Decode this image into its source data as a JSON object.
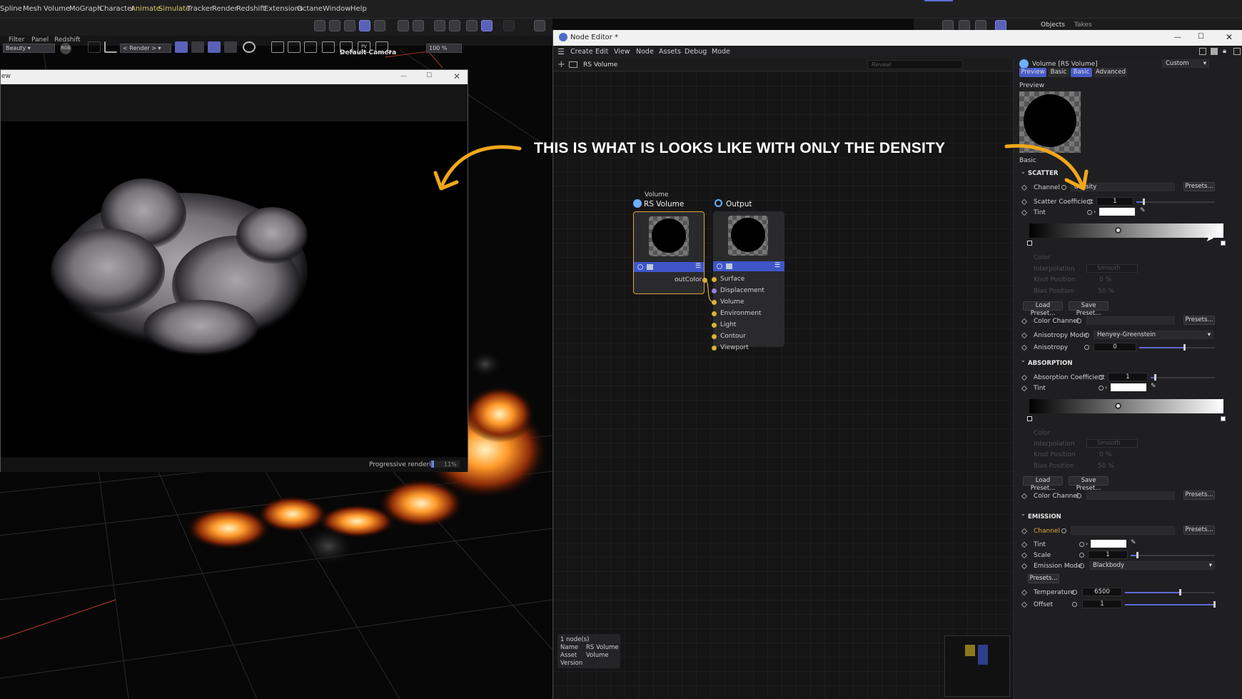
{
  "menubar": {
    "items": [
      "Spline",
      "Mesh",
      "Volume",
      "MoGraph",
      "Character",
      "Animate",
      "Simulate",
      "Tracker",
      "Render",
      "Redshift",
      "Extensions",
      "Octane",
      "Window",
      "Help"
    ],
    "right_tabs": [
      "Objects",
      "Takes"
    ]
  },
  "viewport": {
    "menu": [
      "Filter",
      "Panel",
      "Redshift"
    ],
    "camera_label": "Default Camera"
  },
  "render_view": {
    "title": "ew",
    "aov_select": "Beauty",
    "render_select": "< Render >",
    "zoom": "100 %",
    "status": "Progressive rendering",
    "progress_text": "11%",
    "progress": 0.11,
    "rgb_label": "RGB",
    "pv_label": "PV"
  },
  "annotation": "THIS IS WHAT IS LOOKS LIKE WITH ONLY THE DENSITY",
  "node_editor": {
    "title": "Node Editor *",
    "menu": [
      "Create",
      "Edit",
      "View",
      "Node",
      "Assets",
      "Debug",
      "Mode"
    ],
    "path": "RS Volume",
    "search_placeholder": "Reveal",
    "nodes": {
      "volume": {
        "type_label": "Volume",
        "name": "RS Volume",
        "output_port": "outColor"
      },
      "output": {
        "name": "Output",
        "ports": [
          "Surface",
          "Displacement",
          "Volume",
          "Environment",
          "Light",
          "Contour",
          "Viewport"
        ]
      }
    },
    "info": {
      "count": "1 node(s)",
      "name_label": "Name",
      "name_value": "RS Volume",
      "asset_label": "Asset",
      "asset_value": "Volume",
      "version_label": "Version"
    }
  },
  "attributes": {
    "title": "Volume [RS Volume]",
    "layout_select": "Custom",
    "tabs": [
      "Preview",
      "Basic",
      "Basic",
      "Advanced"
    ],
    "preview_label": "Preview",
    "basic_label": "Basic",
    "scatter": {
      "header": "SCATTER",
      "channel_label": "Channel",
      "channel_value": "density",
      "presets": "Presets...",
      "coef_label": "Scatter Coefficient",
      "coef_value": "1",
      "coef_level": 0.08,
      "tint_label": "Tint",
      "color_label": "Color",
      "interp_label": "Interpolation",
      "interp_value": "Smooth",
      "knot_label": "Knot Position",
      "knot_value": "0 %",
      "bias_label": "Bias Position",
      "bias_value": "50 %",
      "load": "Load Preset...",
      "save": "Save Preset...",
      "color_channel_label": "Color Channel",
      "aniso_mode_label": "Anisotropy Mode",
      "aniso_mode_value": "Henyey-Greenstein",
      "aniso_label": "Anisotropy",
      "aniso_value": "0"
    },
    "absorption": {
      "header": "ABSORPTION",
      "coef_label": "Absorption Coefficient",
      "coef_value": "1",
      "tint_label": "Tint",
      "color_label": "Color",
      "interp_label": "Interpolation",
      "interp_value": "Smooth",
      "knot_label": "Knot Position",
      "knot_value": "0 %",
      "bias_label": "Bias Position",
      "bias_value": "50 %",
      "load": "Load Preset...",
      "save": "Save Preset...",
      "color_channel_label": "Color Channel",
      "presets": "Presets..."
    },
    "emission": {
      "header": "EMISSION",
      "channel_label": "Channel",
      "presets": "Presets...",
      "tint_label": "Tint",
      "scale_label": "Scale",
      "scale_value": "1",
      "mode_label": "Emission Mode",
      "mode_value": "Blackbody",
      "temp_label": "Temperature",
      "temp_value": "6500",
      "offset_label": "Offset",
      "offset_value": "1"
    }
  },
  "colors": {
    "accent": "#5d6cd6",
    "node_header": "#3f55c9",
    "port": "#d8b234",
    "annotation_arrow": "#f2a71b",
    "selection": "#e0a53a"
  }
}
